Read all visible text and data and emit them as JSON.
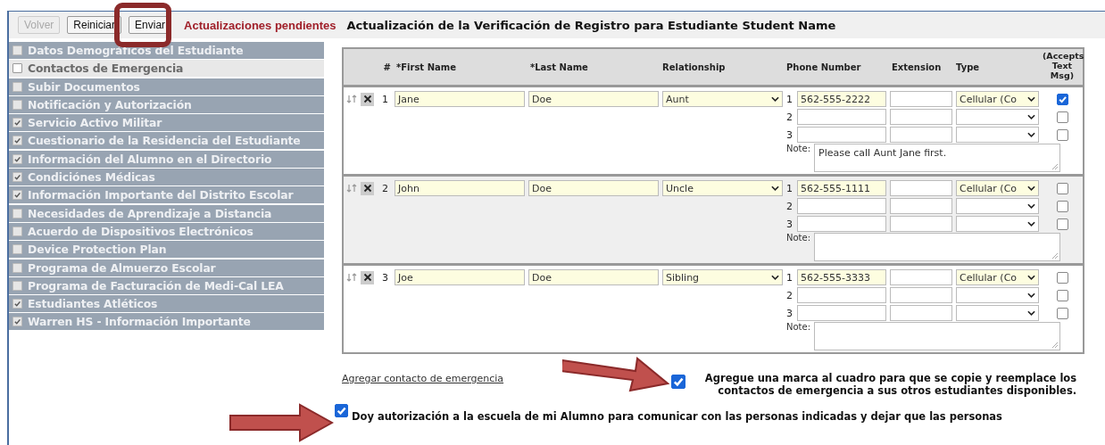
{
  "toolbar": {
    "buttons": [
      {
        "label": "Volver",
        "disabled": true
      },
      {
        "label": "Reiniciar",
        "disabled": false
      },
      {
        "label": "Enviar",
        "disabled": false
      }
    ],
    "status": "Actualizaciones pendientes",
    "title": "Actualización de la Verificación de Registro para Estudiante Student Name"
  },
  "sidebar": {
    "items": [
      {
        "label": "Datos Demográficos del Estudiante",
        "checked": false,
        "selected": false
      },
      {
        "label": "Contactos de Emergencia",
        "checked": false,
        "selected": true
      },
      {
        "label": "Subir Documentos",
        "checked": false,
        "selected": false
      },
      {
        "label": "Notificación y Autorización",
        "checked": false,
        "selected": false
      },
      {
        "label": "Servicio Activo Militar",
        "checked": true,
        "selected": false
      },
      {
        "label": "Cuestionario de la Residencia del Estudiante",
        "checked": true,
        "selected": false
      },
      {
        "label": "Información del Alumno en el Directorio",
        "checked": true,
        "selected": false
      },
      {
        "label": "Condiciónes Médicas",
        "checked": true,
        "selected": false
      },
      {
        "label": "Información Importante del Distrito Escolar",
        "checked": true,
        "selected": false
      },
      {
        "label": "Necesidades de Aprendizaje a Distancia",
        "checked": false,
        "selected": false
      },
      {
        "label": "Acuerdo de Dispositivos Electrónicos",
        "checked": false,
        "selected": false
      },
      {
        "label": "Device Protection Plan",
        "checked": false,
        "selected": false
      },
      {
        "label": "Programa de Almuerzo Escolar",
        "checked": false,
        "selected": false
      },
      {
        "label": "Programa de Facturación de Medi-Cal LEA",
        "checked": false,
        "selected": false
      },
      {
        "label": "Estudiantes Atléticos",
        "checked": true,
        "selected": false
      },
      {
        "label": "Warren HS - Información Importante",
        "checked": true,
        "selected": false
      }
    ]
  },
  "contacts": {
    "columns": [
      "#",
      "*First Name",
      "*Last Name",
      "Relationship",
      "Phone Number",
      "Extension",
      "Type",
      "(Accepts Text Msg)"
    ],
    "rows": [
      {
        "number": "1",
        "first_name": "Jane",
        "last_name": "Doe",
        "relationship": "Aunt",
        "note_label": "Note:",
        "note": "Please call Aunt Jane first.",
        "phones": [
          {
            "index": "1",
            "number": "562-555-2222",
            "type": "Cellular (Co",
            "accepts_text": true
          },
          {
            "index": "2",
            "accepts_text": false
          },
          {
            "index": "3",
            "accepts_text": false
          }
        ]
      },
      {
        "number": "2",
        "first_name": "John",
        "last_name": "Doe",
        "relationship": "Uncle",
        "note_label": "Note:",
        "phones": [
          {
            "index": "1",
            "number": "562-555-1111",
            "type": "Cellular (Co",
            "accepts_text": false
          },
          {
            "index": "2",
            "accepts_text": false
          },
          {
            "index": "3",
            "accepts_text": false
          }
        ]
      },
      {
        "number": "3",
        "first_name": "Joe",
        "last_name": "Doe",
        "relationship": "Sibling",
        "note_label": "Note:",
        "phones": [
          {
            "index": "1",
            "number": "562-555-3333",
            "type": "Cellular (Co",
            "accepts_text": false
          },
          {
            "index": "2",
            "accepts_text": false
          },
          {
            "index": "3",
            "accepts_text": false
          }
        ]
      }
    ]
  },
  "add_contact_link": "Agregar contacto de emergencia",
  "copy_option": {
    "text": "Agregue una marca al cuadro para que se copie y reemplace los contactos de emergencia a sus otros estudiantes disponibles.",
    "checked": true
  },
  "authorization": {
    "text": "Doy autorización a la escuela de mi Alumno para comunicar con las personas indicadas y dejar que las personas",
    "checked": true
  }
}
